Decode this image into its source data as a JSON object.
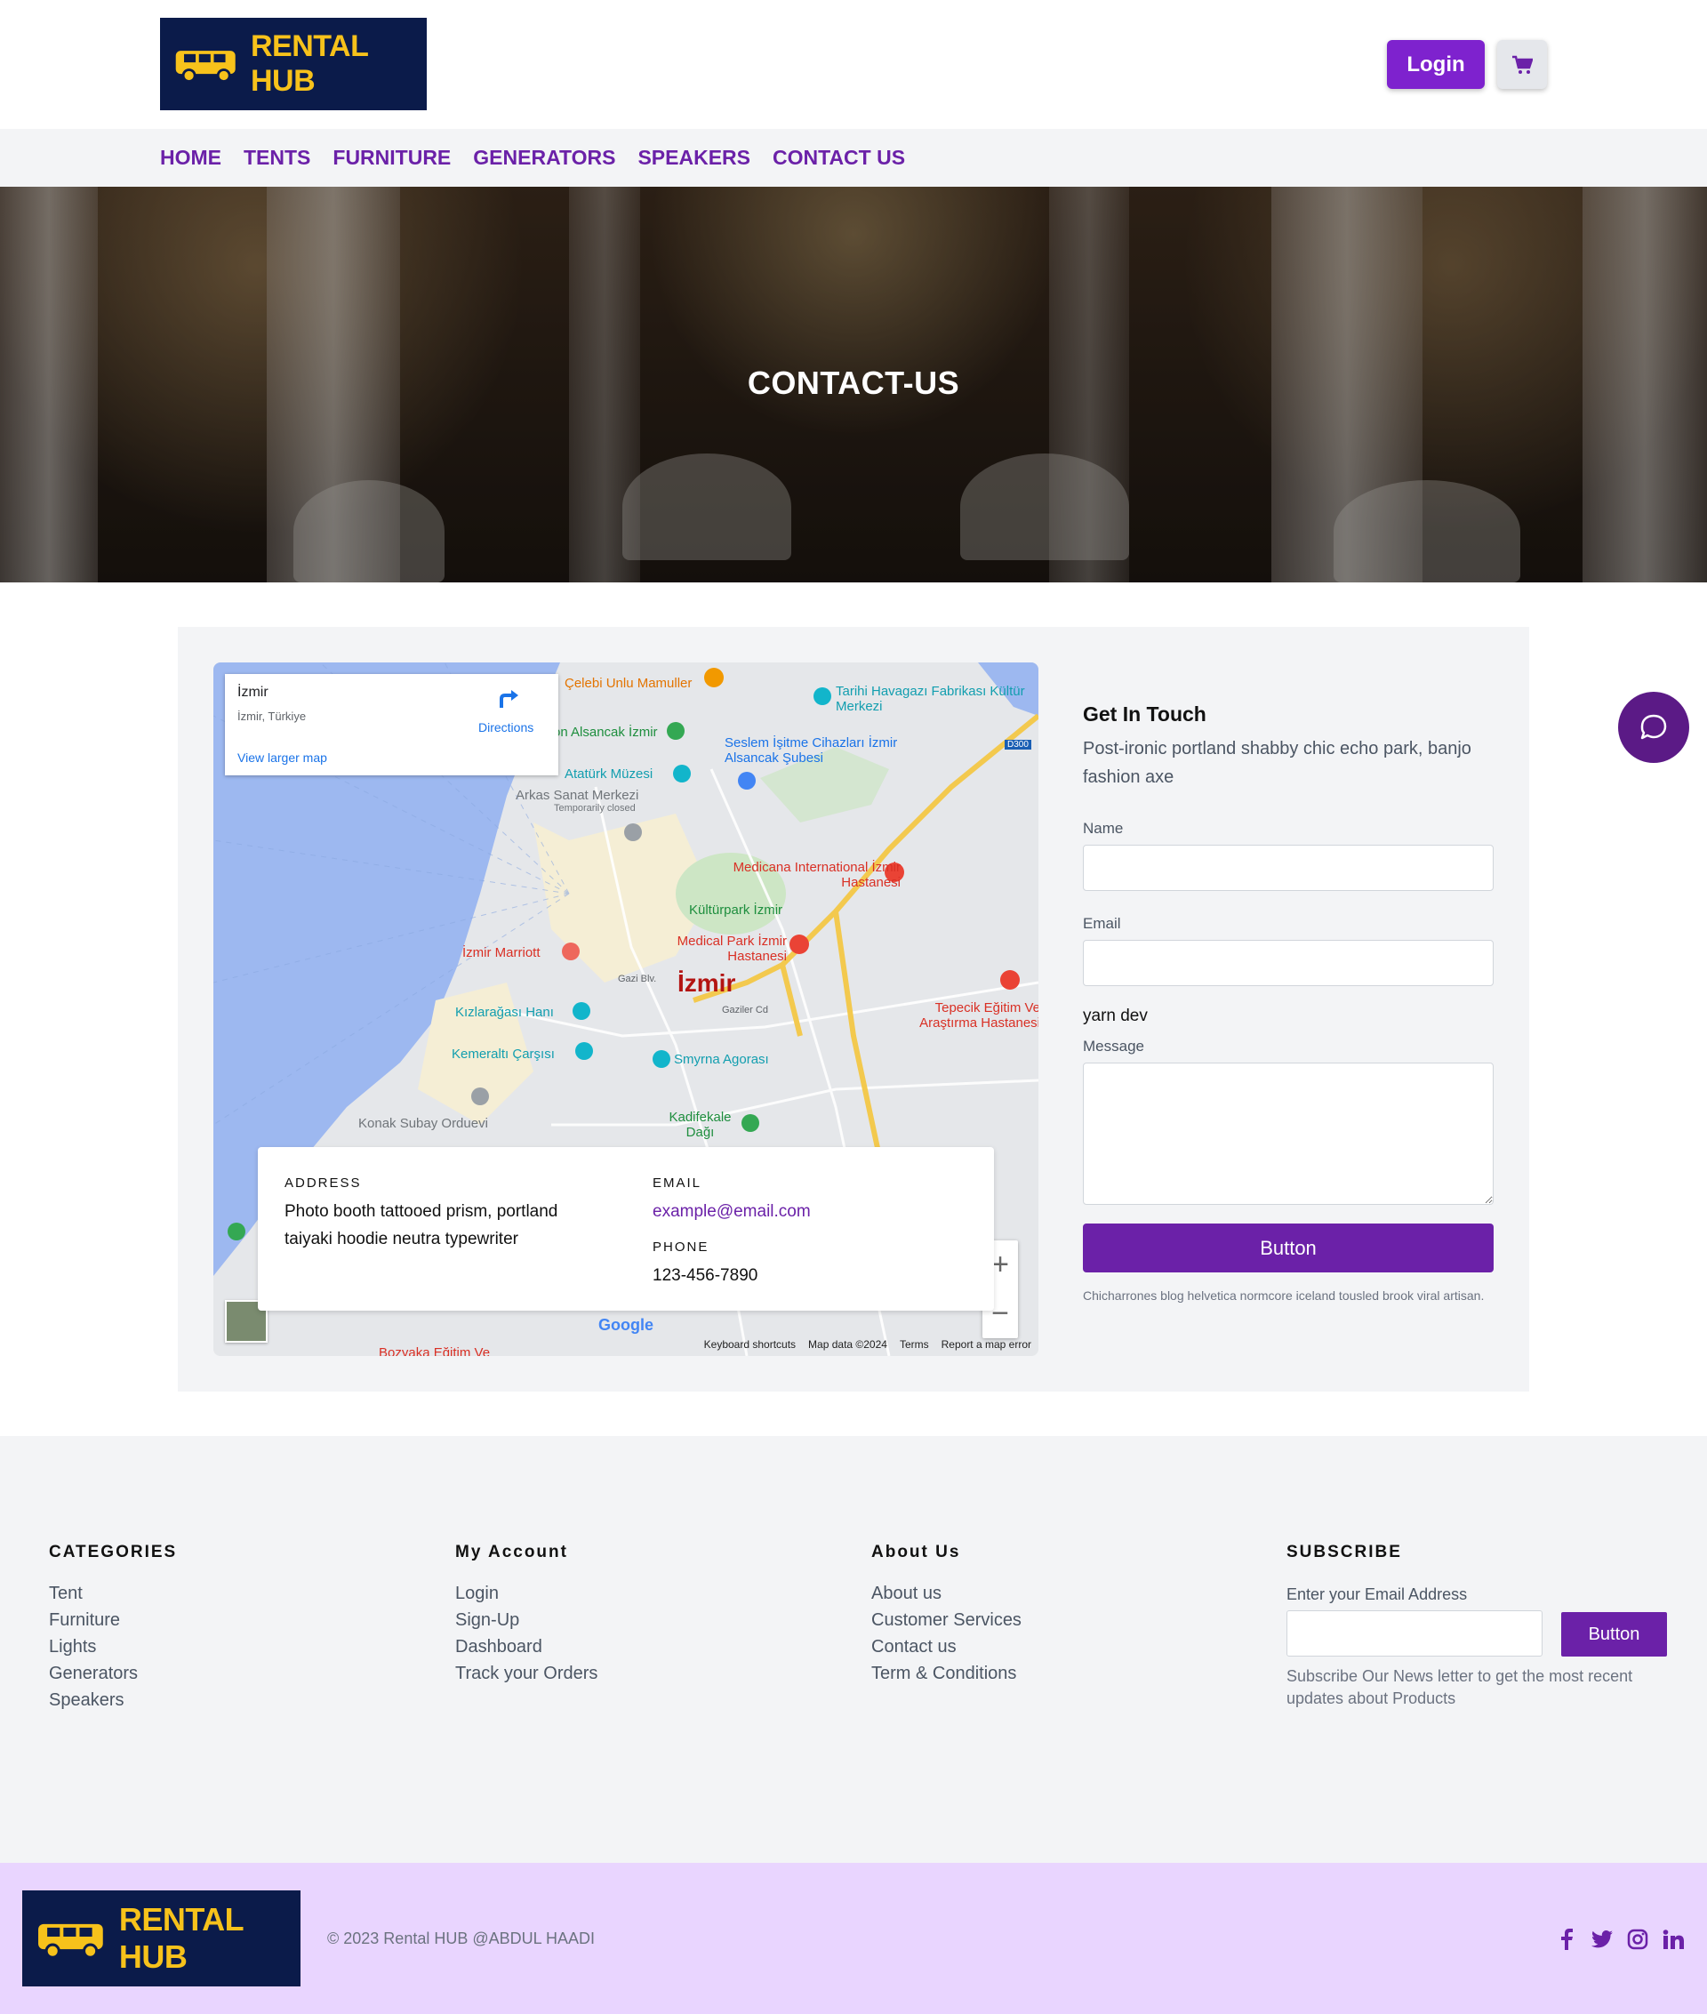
{
  "header": {
    "brand": "RENTAL HUB",
    "login_label": "Login"
  },
  "nav": {
    "items": [
      "HOME",
      "TENTS",
      "FURNITURE",
      "GENERATORS",
      "SPEAKERS",
      "CONTACT US"
    ]
  },
  "hero": {
    "title": "CONTACT-US"
  },
  "map": {
    "city": "İzmir",
    "subtitle": "İzmir, Türkiye",
    "directions_label": "Directions",
    "larger_map_label": "View larger map",
    "labels": {
      "celebi": "Çelebi Unlu Mamuller",
      "tarihi": "Tarihi Havagazı Fabrikası Kültür Merkezi",
      "alsancak": "on Alsancak İzmir",
      "seslem": "Seslem İşitme Cihazları İzmir Alsancak Şubesi",
      "ataturk": "Atatürk Müzesi",
      "arkas": "Arkas Sanat Merkezi",
      "temp": "Temporarily closed",
      "medicana": "Medicana International İzmir Hastanesi",
      "kulturpark": "Kültürpark İzmir",
      "marriott": "İzmir Marriott",
      "medical": "Medical Park İzmir Hastanesi",
      "izmir": "İzmir",
      "tepecik": "Tepecik Eğitim Ve Araştırma Hastanesi",
      "kizlaragasi": "Kızlarağası Hanı",
      "kemeralti": "Kemeraltı Çarşısı",
      "smyrna": "Smyrna Agorası",
      "konak": "Konak Subay Orduevi",
      "kadifekale": "Kadifekale Dağı",
      "bozyaka": "Bozyaka Eğitim Ve",
      "d300": "D300",
      "gazi": "Gazi Blv.",
      "gaziler": "Gaziler Cd"
    },
    "footer_links": [
      "Keyboard shortcuts",
      "Map data ©2024",
      "Terms",
      "Report a map error"
    ],
    "google": "Google"
  },
  "info": {
    "address_label": "ADDRESS",
    "address": "Photo booth tattooed prism, portland taiyaki hoodie neutra typewriter",
    "email_label": "EMAIL",
    "email": "example@email.com",
    "phone_label": "PHONE",
    "phone": "123-456-7890"
  },
  "form": {
    "title": "Get In Touch",
    "description": "Post-ironic portland shabby chic echo park, banjo fashion axe",
    "name_label": "Name",
    "email_label": "Email",
    "yarn": "yarn dev",
    "message_label": "Message",
    "button": "Button",
    "note": "Chicharrones blog helvetica normcore iceland tousled brook viral artisan."
  },
  "footer": {
    "categories": {
      "title": "CATEGORIES",
      "links": [
        "Tent",
        "Furniture",
        "Lights",
        "Generators",
        "Speakers"
      ]
    },
    "account": {
      "title": "My Account",
      "links": [
        "Login",
        "Sign-Up",
        "Dashboard",
        "Track your Orders"
      ]
    },
    "about": {
      "title": "About Us",
      "links": [
        "About us",
        "Customer Services",
        "Contact us",
        "Term & Conditions"
      ]
    },
    "subscribe": {
      "title": "SUBSCRIBE",
      "label": "Enter your Email Address",
      "button": "Button",
      "note": "Subscribe Our News letter to get the most recent updates about Products"
    }
  },
  "bottom": {
    "brand": "RENTAL HUB",
    "copyright": "© 2023 Rental HUB @ABDUL HAADI",
    "social": [
      "facebook-icon",
      "twitter-icon",
      "instagram-icon",
      "linkedin-icon"
    ]
  },
  "colors": {
    "primary": "#6b21a8",
    "brand_bg": "#0b1b4a",
    "brand_yellow": "#f7c21b"
  }
}
